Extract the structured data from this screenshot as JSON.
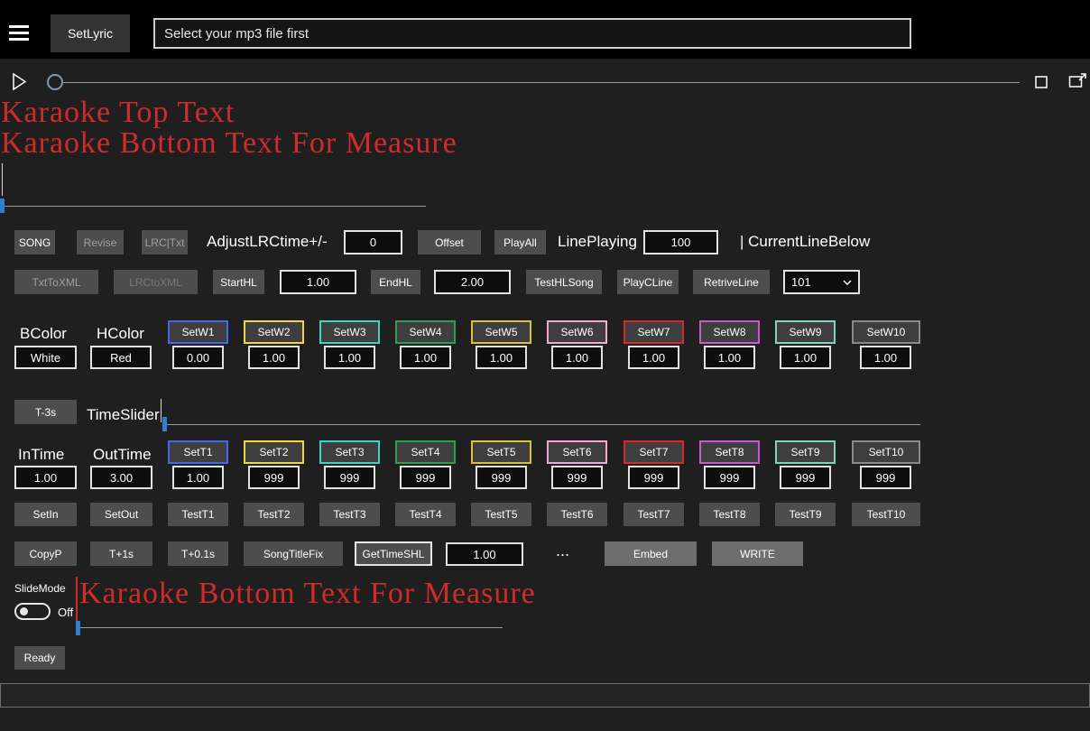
{
  "colors": {
    "accent_blue": "#2e7ed2",
    "karaoke_red": "#cf2b2b"
  },
  "icons": {
    "menu": "hamburger-menu",
    "play": "play-outline-triangle",
    "stop": "stop-square",
    "popout": "popout-window",
    "dropdown": "chevron-down"
  },
  "topbar": {
    "app_button": "SetLyric",
    "mp3_placeholder": "Select your mp3 file first"
  },
  "karaoke_preview": {
    "top_line": "Karaoke Top Text",
    "bottom_line": "Karaoke Bottom Text For Measure"
  },
  "row1": {
    "song": "SONG",
    "revise": "Revise",
    "lrc_txt": "LRC|Txt",
    "adjust_label": "AdjustLRCtime+/-",
    "adjust_value": "0",
    "offset": "Offset",
    "play_all": "PlayAll",
    "line_playing_label": "LinePlaying",
    "line_playing_value": "100",
    "current_line_label": "| CurrentLineBelow"
  },
  "row2": {
    "txt_to_xml": "TxtToXML",
    "lrc_to_xml": "LRCtoXML",
    "start_hl": "StartHL",
    "start_hl_value": "1.00",
    "end_hl": "EndHL",
    "end_hl_value": "2.00",
    "test_hl_song": "TestHLSong",
    "play_c_line": "PlayCLine",
    "retrive_line": "RetriveLine",
    "line_select_value": "101"
  },
  "color_section": {
    "bcolor_label": "BColor",
    "hcolor_label": "HColor",
    "bcolor_value": "White",
    "hcolor_value": "Red",
    "setw": [
      {
        "label": "SetW1",
        "value": "0.00",
        "border": "#4169e1"
      },
      {
        "label": "SetW2",
        "value": "1.00",
        "border": "#efd73c"
      },
      {
        "label": "SetW3",
        "value": "1.00",
        "border": "#3fd4c4"
      },
      {
        "label": "SetW4",
        "value": "1.00",
        "border": "#2f9e4f"
      },
      {
        "label": "SetW5",
        "value": "1.00",
        "border": "#d8c23a"
      },
      {
        "label": "SetW6",
        "value": "1.00",
        "border": "#f2a8cf"
      },
      {
        "label": "SetW7",
        "value": "1.00",
        "border": "#d22b2b"
      },
      {
        "label": "SetW8",
        "value": "1.00",
        "border": "#c65ac6"
      },
      {
        "label": "SetW9",
        "value": "1.00",
        "border": "#7fd4c1"
      },
      {
        "label": "SetW10",
        "value": "1.00",
        "border": "#8a8a8a"
      }
    ]
  },
  "timeslider_row": {
    "t_minus_3s": "T-3s",
    "label": "TimeSlider"
  },
  "time_section": {
    "in_time_label": "InTime",
    "out_time_label": "OutTime",
    "in_time_value": "1.00",
    "out_time_value": "3.00",
    "sett": [
      {
        "label": "SetT1",
        "value": "1.00",
        "border": "#4169e1"
      },
      {
        "label": "SetT2",
        "value": "999",
        "border": "#efd73c"
      },
      {
        "label": "SetT3",
        "value": "999",
        "border": "#3fd4c4"
      },
      {
        "label": "SetT4",
        "value": "999",
        "border": "#2f9e4f"
      },
      {
        "label": "SetT5",
        "value": "999",
        "border": "#d8c23a"
      },
      {
        "label": "SetT6",
        "value": "999",
        "border": "#f2a8cf"
      },
      {
        "label": "SetT7",
        "value": "999",
        "border": "#d22b2b"
      },
      {
        "label": "SetT8",
        "value": "999",
        "border": "#c65ac6"
      },
      {
        "label": "SetT9",
        "value": "999",
        "border": "#7fd4c1"
      },
      {
        "label": "SetT10",
        "value": "999",
        "border": "#8a8a8a"
      }
    ],
    "set_in": "SetIn",
    "set_out": "SetOut",
    "testt": [
      "TestT1",
      "TestT2",
      "TestT3",
      "TestT4",
      "TestT5",
      "TestT6",
      "TestT7",
      "TestT8",
      "TestT9",
      "TestT10"
    ]
  },
  "actions": {
    "copy_p": "CopyP",
    "t_plus_1s": "T+1s",
    "t_plus_01s": "T+0.1s",
    "song_title_fix": "SongTitleFix",
    "get_time_shl": "GetTimeSHL",
    "get_time_value": "1.00",
    "dots": "...",
    "embed": "Embed",
    "write": "WRITE"
  },
  "bottom": {
    "slide_mode_label": "SlideMode",
    "toggle_label": "Off",
    "karaoke_line": "Karaoke Bottom Text For Measure",
    "ready": "Ready"
  }
}
